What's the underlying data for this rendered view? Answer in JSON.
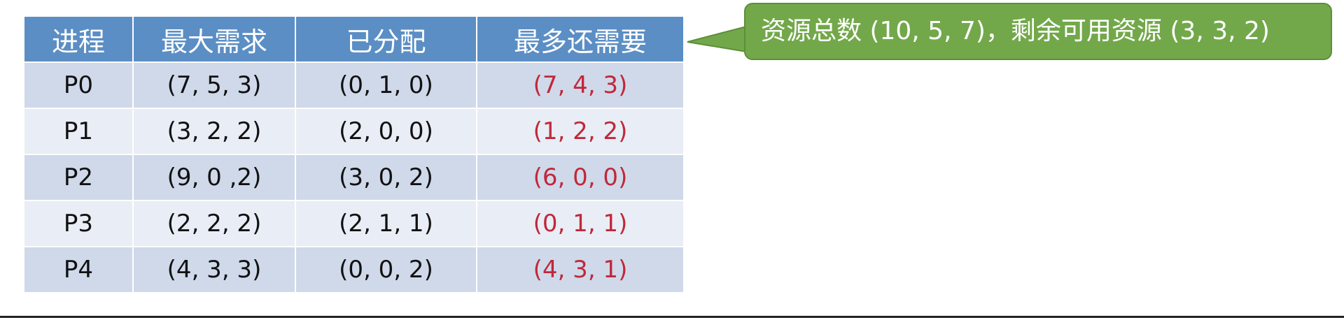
{
  "table": {
    "headers": [
      "进程",
      "最大需求",
      "已分配",
      "最多还需要"
    ],
    "rows": [
      {
        "process": "P0",
        "max": "(7, 5, 3)",
        "allocated": "(0, 1, 0)",
        "need": "(7, 4, 3)"
      },
      {
        "process": "P1",
        "max": "(3, 2, 2)",
        "allocated": "(2, 0, 0)",
        "need": "(1, 2, 2)"
      },
      {
        "process": "P2",
        "max": "(9, 0 ,2)",
        "allocated": "(3, 0, 2)",
        "need": "(6, 0, 0)"
      },
      {
        "process": "P3",
        "max": "(2, 2, 2)",
        "allocated": "(2, 1, 1)",
        "need": "(0, 1, 1)"
      },
      {
        "process": "P4",
        "max": "(4, 3, 3)",
        "allocated": "(0, 0, 2)",
        "need": "(4, 3, 1)"
      }
    ]
  },
  "callout": {
    "text": "资源总数 (10, 5, 7)，剩余可用资源 (3, 3, 2)"
  },
  "colors": {
    "header_bg": "#5b8ec4",
    "row_dark": "#cfd9ea",
    "row_light": "#e9edf5",
    "need_text": "#c0283a",
    "callout_bg": "#72a84a"
  }
}
